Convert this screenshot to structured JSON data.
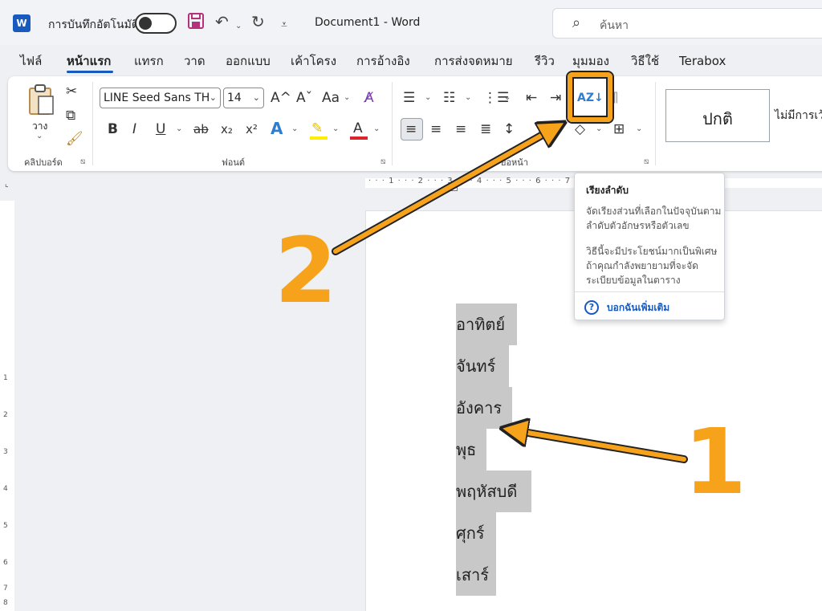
{
  "titlebar": {
    "app_icon": "W",
    "autosave_label": "การบันทึกอัตโนมัติ",
    "doc_title": "Document1  -  Word",
    "search_placeholder": "ค้นหา"
  },
  "tabs": [
    "ไฟล์",
    "หน้าแรก",
    "แทรก",
    "วาด",
    "ออกแบบ",
    "เค้าโครง",
    "การอ้างอิง",
    "การส่งจดหมาย",
    "รีวิว",
    "มุมมอง",
    "วิธีใช้",
    "Terabox"
  ],
  "active_tab": "หน้าแรก",
  "ribbon": {
    "clipboard": {
      "paste_label": "วาง",
      "group_label": "คลิปบอร์ด"
    },
    "font": {
      "font_name": "LINE Seed Sans TH",
      "font_size": "14",
      "group_label": "ฟอนต์",
      "bold": "B",
      "italic": "I",
      "underline": "U",
      "strike": "ab",
      "subscript": "x₂",
      "superscript": "x²",
      "text_effect": "A",
      "font_color": "A",
      "grow": "A^",
      "shrink": "Aˇ",
      "case": "Aa"
    },
    "paragraph": {
      "group_label": "ย่อหน้า"
    },
    "styles": {
      "normal": "ปกติ",
      "no_spacing": "ไม่มีการเว้น"
    }
  },
  "ruler": {
    "horizontal": "· · · 1 · · · 2 · · · 3 · · · 4 · · · 5 · · · 6 · · · 7 · · · 8 · · · 9 · · ·",
    "vertical_numbers": [
      "1",
      "2",
      "3",
      "4",
      "5",
      "6",
      "7",
      "8"
    ]
  },
  "tooltip": {
    "title": "เรียงลำดับ",
    "body1": "จัดเรียงส่วนที่เลือกในปัจจุบันตามลำดับตัวอักษรหรือตัวเลข",
    "body2": "วิธีนี้จะมีประโยชน์มากเป็นพิเศษถ้าคุณกำลังพยายามที่จะจัดระเบียบข้อมูลในตาราง",
    "help": "บอกฉันเพิ่มเติม"
  },
  "document_lines": [
    "อาทิตย์",
    "จันทร์",
    "อังคาร",
    "พุธ",
    "พฤหัสบดี",
    "ศุกร์",
    "เสาร์"
  ],
  "annotations": {
    "label_1": "1",
    "label_2": "2",
    "color": "#f7a21b"
  }
}
